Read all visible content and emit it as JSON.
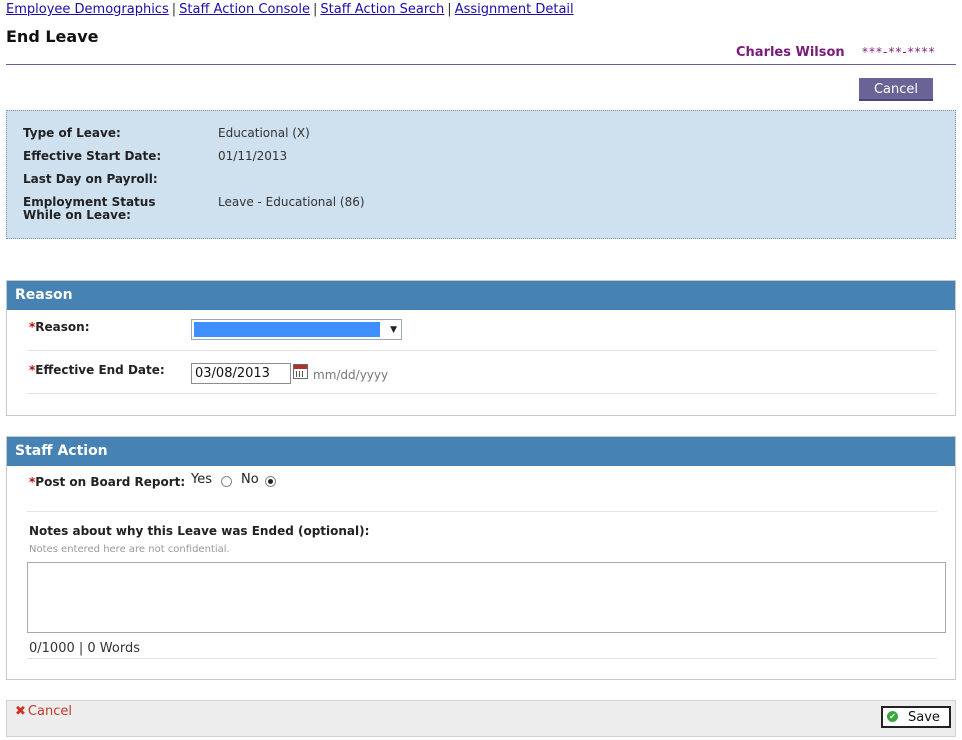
{
  "breadcrumb": [
    {
      "label": "Employee Demographics"
    },
    {
      "label": "Staff Action Console"
    },
    {
      "label": "Staff Action Search"
    },
    {
      "label": "Assignment Detail"
    }
  ],
  "page": {
    "title": "End Leave",
    "employee_name": "Charles Wilson",
    "employee_ssn": "***-**-****",
    "cancel_label": "Cancel"
  },
  "summary": {
    "rows": [
      {
        "label": "Type of Leave:",
        "value": "Educational (X)"
      },
      {
        "label": "Effective Start Date:",
        "value": "01/11/2013"
      },
      {
        "label": "Last Day on Payroll:",
        "value": ""
      },
      {
        "label": "Employment Status While on Leave:",
        "value": "Leave - Educational (86)"
      }
    ]
  },
  "reason_section": {
    "title": "Reason",
    "reason_label": "Reason:",
    "reason_selected": "",
    "end_date_label": "Effective End Date:",
    "end_date_value": "03/08/2013",
    "date_format_hint": "mm/dd/yyyy"
  },
  "staff_action_section": {
    "title": "Staff Action",
    "post_label": "Post on Board Report:",
    "yes_label": "Yes",
    "no_label": "No",
    "post_selected": "No",
    "notes_label": "Notes about why this Leave was Ended (optional):",
    "notes_sublabel": "Notes entered here are not confidential.",
    "notes_value": "",
    "counter": "0/1000 | 0 Words"
  },
  "footer": {
    "cancel_label": "Cancel",
    "save_label": "Save"
  },
  "colors": {
    "section_header": "#4682b4",
    "summary_bg": "#cfe0ef",
    "employee_name": "#7a1a7a",
    "cancel_button": "#6a6496",
    "required_marker": "#cc0000"
  }
}
